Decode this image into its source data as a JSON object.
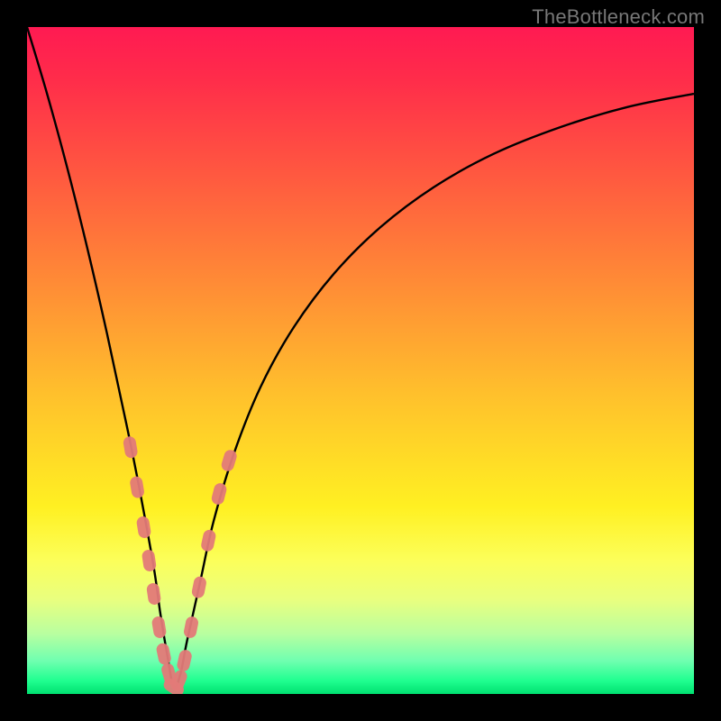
{
  "watermark": "TheBottleneck.com",
  "colors": {
    "frame": "#000000",
    "curve": "#000000",
    "marker": "#e37a78",
    "gradient_stops": [
      "#ff1a52",
      "#ff5840",
      "#ffc02c",
      "#fff022",
      "#00e070"
    ]
  },
  "chart_data": {
    "type": "line",
    "title": "",
    "xlabel": "",
    "ylabel": "",
    "xlim": [
      0,
      100
    ],
    "ylim": [
      0,
      100
    ],
    "grid": false,
    "note": "Axes are unlabeled; values are estimated as percentage of plot width/height. y is height above bottom; dip reaches ~0 at x≈22.",
    "series": [
      {
        "name": "v-curve",
        "x": [
          0,
          3,
          6,
          9,
          12,
          15,
          17,
          19,
          20,
          21,
          22,
          23,
          24,
          26,
          28,
          31,
          35,
          40,
          46,
          53,
          61,
          70,
          80,
          90,
          100
        ],
        "y": [
          100,
          90,
          79,
          67,
          54,
          40,
          30,
          19,
          12,
          6,
          1,
          3,
          8,
          17,
          26,
          36,
          46,
          55,
          63,
          70,
          76,
          81,
          85,
          88,
          90
        ]
      }
    ],
    "markers": {
      "name": "highlighted-points",
      "description": "Salmon capsule-shaped markers clustered near the curve's minimum on both branches",
      "points": [
        {
          "x": 15.5,
          "y": 37
        },
        {
          "x": 16.5,
          "y": 31
        },
        {
          "x": 17.5,
          "y": 25
        },
        {
          "x": 18.3,
          "y": 20
        },
        {
          "x": 19.0,
          "y": 15
        },
        {
          "x": 19.8,
          "y": 10
        },
        {
          "x": 20.5,
          "y": 6
        },
        {
          "x": 21.3,
          "y": 3
        },
        {
          "x": 22.0,
          "y": 1
        },
        {
          "x": 22.8,
          "y": 2
        },
        {
          "x": 23.6,
          "y": 5
        },
        {
          "x": 24.6,
          "y": 10
        },
        {
          "x": 25.8,
          "y": 16
        },
        {
          "x": 27.2,
          "y": 23
        },
        {
          "x": 28.8,
          "y": 30
        },
        {
          "x": 30.3,
          "y": 35
        }
      ]
    }
  }
}
